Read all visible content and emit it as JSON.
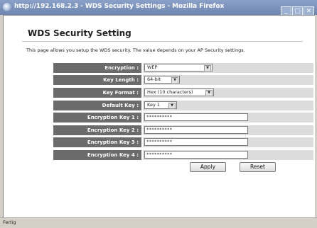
{
  "window": {
    "title": "http://192.168.2.3 - WDS Security Settings - Mozilla Firefox",
    "minimize": "_",
    "maximize": "□",
    "close": "✕"
  },
  "page": {
    "heading": "WDS Security Setting",
    "description": "This page allows you setup the WDS security. The value depends on your AP Security settings."
  },
  "form": {
    "encryption": {
      "label": "Encryption :",
      "value": "WEP"
    },
    "key_length": {
      "label": "Key Length :",
      "value": "64-bit"
    },
    "key_format": {
      "label": "Key Format :",
      "value": "Hex (10 characters)"
    },
    "default_key": {
      "label": "Default Key :",
      "value": "Key 1"
    },
    "key1": {
      "label": "Encryption Key 1 :",
      "value": "**********"
    },
    "key2": {
      "label": "Encryption Key 2 :",
      "value": "**********"
    },
    "key3": {
      "label": "Encryption Key 3 :",
      "value": "**********"
    },
    "key4": {
      "label": "Encryption Key 4 :",
      "value": "**********"
    }
  },
  "buttons": {
    "apply": "Apply",
    "reset": "Reset"
  },
  "status": {
    "text": "Fertig"
  },
  "icons": {
    "window": "firefox-icon",
    "dropdown": "chevron-down-icon"
  }
}
